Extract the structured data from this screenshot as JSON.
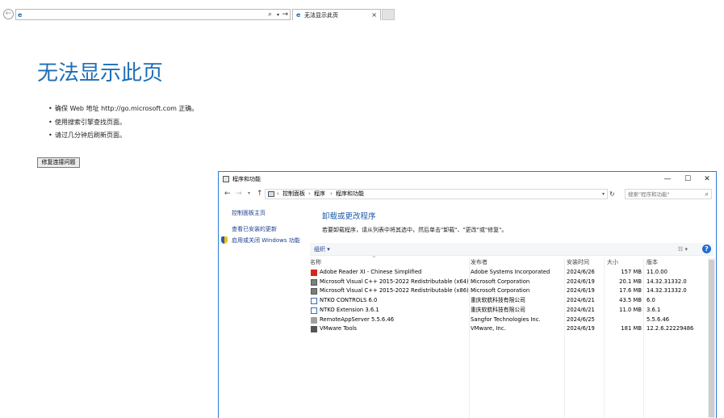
{
  "ie": {
    "back_glyph": "←",
    "address_value": "",
    "search_glyph": "⌕",
    "dropdown_glyph": "▾",
    "go_glyph": "→",
    "tab_title": "无法显示此页",
    "tab_close": "×",
    "favicon_glyph": "e"
  },
  "error_page": {
    "title": "无法显示此页",
    "bullets": [
      "确保 Web 地址 http://go.microsoft.com 正确。",
      "使用搜索引擎查找页面。",
      "请过几分钟后刷新页面。"
    ],
    "fix_button": "修复连接问题"
  },
  "window": {
    "title": "程序和功能",
    "min_glyph": "—",
    "max_glyph": "☐",
    "close_glyph": "✕",
    "nav": {
      "back": "←",
      "forward": "→",
      "history": "▾",
      "up": "↑",
      "breadcrumb": [
        "控制面板",
        "程序",
        "程序和功能"
      ],
      "chevron": "›",
      "dropdown": "▾",
      "refresh": "↻",
      "search_placeholder": "搜索\"程序和功能\"",
      "search_glyph": "⌕"
    },
    "sidebar": {
      "home": "控制面板主页",
      "updates": "查看已安装的更新",
      "features": "启用或关闭 Windows 功能"
    },
    "main": {
      "title": "卸载或更改程序",
      "description": "若要卸载程序，请从列表中将其选中，然后单击\"卸载\"、\"更改\"或\"修复\"。"
    },
    "toolbar": {
      "organize": "组织 ▾",
      "view": "☷ ▾",
      "help": "?"
    },
    "columns": {
      "sort_caret": "^",
      "name": "名称",
      "publisher": "发布者",
      "date": "安装时间",
      "size": "大小",
      "version": "版本"
    },
    "programs": [
      {
        "name": "Adobe Reader XI - Chinese Simplified",
        "publisher": "Adobe Systems Incorporated",
        "date": "2024/6/26",
        "size": "157 MB",
        "version": "11.0.00",
        "icon": "adobe-icon"
      },
      {
        "name": "Microsoft Visual C++ 2015-2022 Redistributable (x64) ...",
        "publisher": "Microsoft Corporation",
        "date": "2024/6/19",
        "size": "20.1 MB",
        "version": "14.32.31332.0",
        "icon": "vcredist-icon"
      },
      {
        "name": "Microsoft Visual C++ 2015-2022 Redistributable (x86) ...",
        "publisher": "Microsoft Corporation",
        "date": "2024/6/19",
        "size": "17.6 MB",
        "version": "14.32.31332.0",
        "icon": "vcredist-icon"
      },
      {
        "name": "NTKO CONTROLS 6.0",
        "publisher": "重庆软航科技有限公司",
        "date": "2024/6/21",
        "size": "43.5 MB",
        "version": "6.0",
        "icon": "ntko-icon"
      },
      {
        "name": "NTKO Extension 3.6.1",
        "publisher": "重庆软航科技有限公司",
        "date": "2024/6/21",
        "size": "11.0 MB",
        "version": "3.6.1",
        "icon": "ntko-icon"
      },
      {
        "name": "RemoteAppServer 5.5.6.46",
        "publisher": "Sangfor Technologies Inc.",
        "date": "2024/6/25",
        "size": "",
        "version": "5.5.6.46",
        "icon": "remoteapp-icon"
      },
      {
        "name": "VMware Tools",
        "publisher": "VMware, Inc.",
        "date": "2024/6/19",
        "size": "181 MB",
        "version": "12.2.6.22229486",
        "icon": "vmware-icon"
      }
    ]
  }
}
